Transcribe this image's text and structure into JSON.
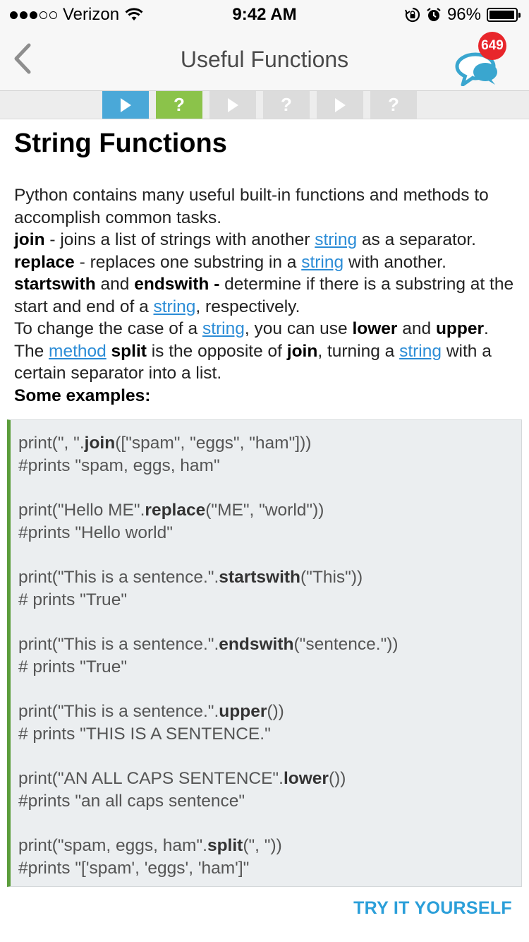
{
  "status_bar": {
    "carrier": "Verizon",
    "time": "9:42 AM",
    "battery_percent": "96%",
    "battery_level": 0.96,
    "signal_bars_filled": 3,
    "signal_bars_total": 5
  },
  "nav": {
    "title": "Useful Functions",
    "badge_count": "649",
    "back_icon": "chevron-left-icon",
    "discuss_icon": "chat-bubbles-icon"
  },
  "progress": {
    "segments": [
      {
        "kind": "play",
        "state": "active"
      },
      {
        "kind": "quiz",
        "state": "active"
      },
      {
        "kind": "play",
        "state": "inactive"
      },
      {
        "kind": "quiz",
        "state": "inactive"
      },
      {
        "kind": "play",
        "state": "inactive"
      },
      {
        "kind": "quiz",
        "state": "inactive"
      }
    ],
    "quiz_symbol": "?"
  },
  "lesson": {
    "title": "String Functions",
    "intro": "Python contains many useful built-in functions and methods to accomplish common tasks.",
    "join": {
      "term": "join",
      "text1": " - joins a list of strings with another ",
      "link": "string",
      "text2": " as a separator."
    },
    "replace": {
      "term": "replace",
      "text1": " - replaces one substring in a ",
      "link": "string",
      "text2": " with another."
    },
    "starts": {
      "term1": "startswith",
      "and": " and ",
      "term2": "endswith -",
      "text1": " determine if there is a substring at the start and end of a ",
      "link": "string",
      "text2": ", respectively."
    },
    "case": {
      "text1": "To change the case of a ",
      "link": "string",
      "text2": ", you can use ",
      "term1": "lower",
      "and": " and ",
      "term2": "upper",
      "text3": "."
    },
    "split": {
      "text1": "The ",
      "link1": "method",
      "term1": " split",
      "text2": " is the opposite of ",
      "term2": "join",
      "text3": ", turning a ",
      "link2": "string",
      "text4": " with a certain separator into a list."
    },
    "examples_heading": "Some examples:"
  },
  "code": {
    "blocks": [
      {
        "pre": "print(\", \".",
        "fn": "join",
        "post": "([\"spam\", \"eggs\", \"ham\"]))",
        "comment": "#prints \"spam, eggs, ham\""
      },
      {
        "pre": "print(\"Hello ME\".",
        "fn": "replace",
        "post": "(\"ME\", \"world\"))",
        "comment": "#prints \"Hello world\""
      },
      {
        "pre": "print(\"This is a sentence.\".",
        "fn": "startswith",
        "post": "(\"This\"))",
        "comment": "# prints \"True\""
      },
      {
        "pre": "print(\"This is a sentence.\".",
        "fn": "endswith",
        "post": "(\"sentence.\"))",
        "comment": "# prints \"True\""
      },
      {
        "pre": "print(\"This is a sentence.\".",
        "fn": "upper",
        "post": "())",
        "comment": "# prints \"THIS IS A SENTENCE.\""
      },
      {
        "pre": "print(\"AN ALL CAPS SENTENCE\".",
        "fn": "lower",
        "post": "())",
        "comment": "#prints \"an all caps sentence\""
      },
      {
        "pre": "print(\"spam, eggs, ham\".",
        "fn": "split",
        "post": "(\", \"))",
        "comment": "#prints \"['spam', 'eggs', 'ham']\""
      }
    ]
  },
  "actions": {
    "try_it": "TRY IT YOURSELF"
  },
  "colors": {
    "link": "#2b8cd6",
    "play_active": "#4aa8d8",
    "quiz_active": "#8bc34a",
    "segment_inactive": "#dcdcdc",
    "code_bar": "#5b9d3b",
    "badge": "#e8262b",
    "try_button": "#2b9fd9"
  }
}
